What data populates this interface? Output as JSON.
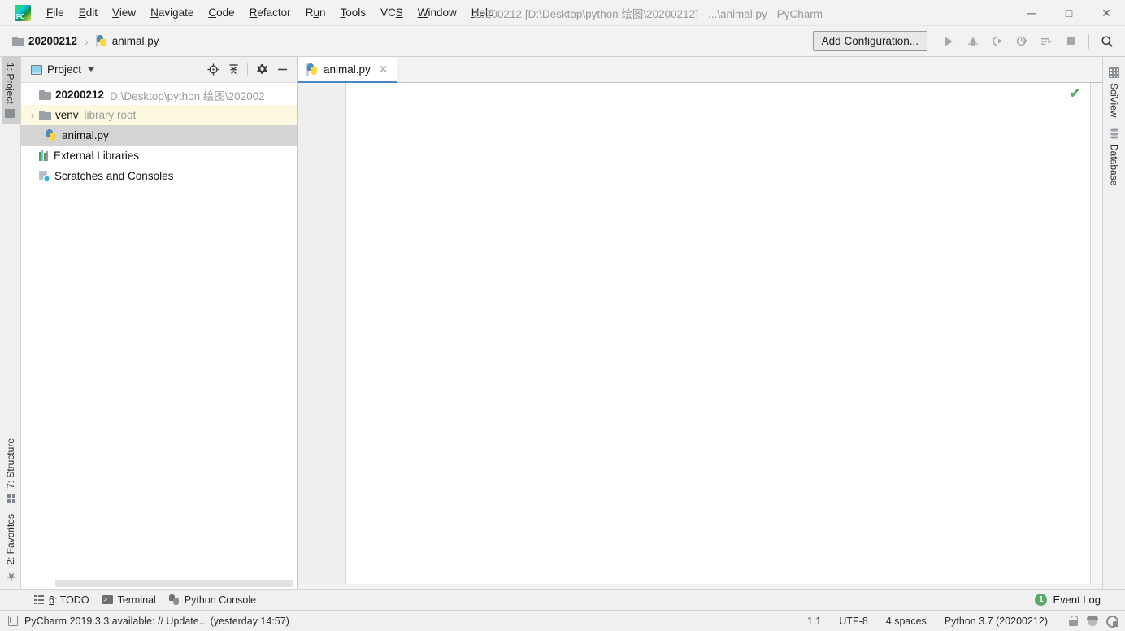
{
  "window": {
    "title": "20200212 [D:\\Desktop\\python 绘图\\20200212] - ...\\animal.py - PyCharm",
    "minimize": "—",
    "maximize": "☐",
    "close": "✕",
    "logo_text": "PC"
  },
  "menubar": {
    "items": [
      {
        "label": "File",
        "mnemonic": "F"
      },
      {
        "label": "Edit",
        "mnemonic": "E"
      },
      {
        "label": "View",
        "mnemonic": "V"
      },
      {
        "label": "Navigate",
        "mnemonic": "N"
      },
      {
        "label": "Code",
        "mnemonic": "C"
      },
      {
        "label": "Refactor",
        "mnemonic": "R"
      },
      {
        "label": "Run",
        "mnemonic": "u"
      },
      {
        "label": "Tools",
        "mnemonic": "T"
      },
      {
        "label": "VCS",
        "mnemonic": "S"
      },
      {
        "label": "Window",
        "mnemonic": "W"
      },
      {
        "label": "Help",
        "mnemonic": "H"
      }
    ]
  },
  "navbar": {
    "breadcrumbs": [
      {
        "label": "20200212",
        "icon": "folder-icon"
      },
      {
        "label": "animal.py",
        "icon": "python-file-icon"
      }
    ],
    "separator": "›",
    "add_configuration": "Add Configuration...",
    "actions": [
      {
        "name": "run-button",
        "glyph": "▶"
      },
      {
        "name": "debug-button",
        "glyph": "ὁE"
      },
      {
        "name": "run-with-coverage-button",
        "glyph": "▷"
      },
      {
        "name": "profile-button",
        "glyph": "◴"
      },
      {
        "name": "run-with-tests-button",
        "glyph": "≡"
      },
      {
        "name": "stop-button",
        "glyph": "■"
      },
      {
        "name": "search-everywhere-button",
        "glyph": "⌕"
      }
    ]
  },
  "left_stripe": {
    "buttons": [
      {
        "label": "1: Project",
        "mnemonic": "1",
        "icon": "project-folder-icon",
        "active": true
      },
      {
        "label": "7: Structure",
        "mnemonic": "7",
        "icon": "structure-icon",
        "active": false
      },
      {
        "label": "2: Favorites",
        "mnemonic": "2",
        "icon": "star-icon",
        "active": false
      }
    ]
  },
  "right_stripe": {
    "buttons": [
      {
        "label": "SciView",
        "icon": "grid-icon"
      },
      {
        "label": "Database",
        "icon": "database-icon"
      }
    ]
  },
  "project_panel": {
    "title": "Project",
    "actions": [
      {
        "name": "locate-icon",
        "glyph": "⊕"
      },
      {
        "name": "collapse-all-icon",
        "glyph": "⥤"
      },
      {
        "name": "settings-gear-icon",
        "glyph": "⚙"
      },
      {
        "name": "hide-panel-icon",
        "glyph": "—"
      }
    ],
    "tree": [
      {
        "label": "20200212",
        "sub": "D:\\Desktop\\python 绘图\\202002",
        "icon": "folder-icon",
        "bold": true,
        "state": "normal",
        "arrow": "",
        "indent": 0
      },
      {
        "label": "venv",
        "sub": "library root",
        "icon": "folder-icon",
        "bold": false,
        "state": "highlighted",
        "arrow": "›",
        "indent": 1
      },
      {
        "label": "animal.py",
        "sub": "",
        "icon": "python-file-icon",
        "bold": false,
        "state": "selected",
        "arrow": "",
        "indent": 1
      },
      {
        "label": "External Libraries",
        "sub": "",
        "icon": "library-icon",
        "bold": false,
        "state": "normal",
        "arrow": "",
        "indent": 0
      },
      {
        "label": "Scratches and Consoles",
        "sub": "",
        "icon": "scratch-icon",
        "bold": false,
        "state": "normal",
        "arrow": "",
        "indent": 0
      }
    ]
  },
  "editor": {
    "tabs": [
      {
        "label": "animal.py",
        "icon": "python-file-icon",
        "close": "✕",
        "active": true
      }
    ],
    "content": "",
    "inspection_mark": "✔"
  },
  "tool_bottom": {
    "items": [
      {
        "label": "6: TODO",
        "mnemonic": "6",
        "icon": "todo-icon"
      },
      {
        "label": "Terminal",
        "mnemonic": "",
        "icon": "terminal-icon"
      },
      {
        "label": "Python Console",
        "mnemonic": "",
        "icon": "python-console-icon"
      }
    ],
    "event_log": {
      "count": "1",
      "label": "Event Log"
    }
  },
  "statusbar": {
    "message": "PyCharm 2019.3.3 available: // Update... (yesterday 14:57)",
    "caret": "1:1",
    "encoding": "UTF-8",
    "indent": "4 spaces",
    "interpreter": "Python 3.7 (20200212)",
    "icons": [
      {
        "name": "lock-icon"
      },
      {
        "name": "inspector-face-icon"
      },
      {
        "name": "settings-search-icon"
      }
    ]
  },
  "colors": {
    "accent": "#4a86c8",
    "highlight_row": "#fdf9e1",
    "selected_row": "#d4d4d4",
    "green": "#59a869",
    "chrome": "#f2f2f2"
  }
}
